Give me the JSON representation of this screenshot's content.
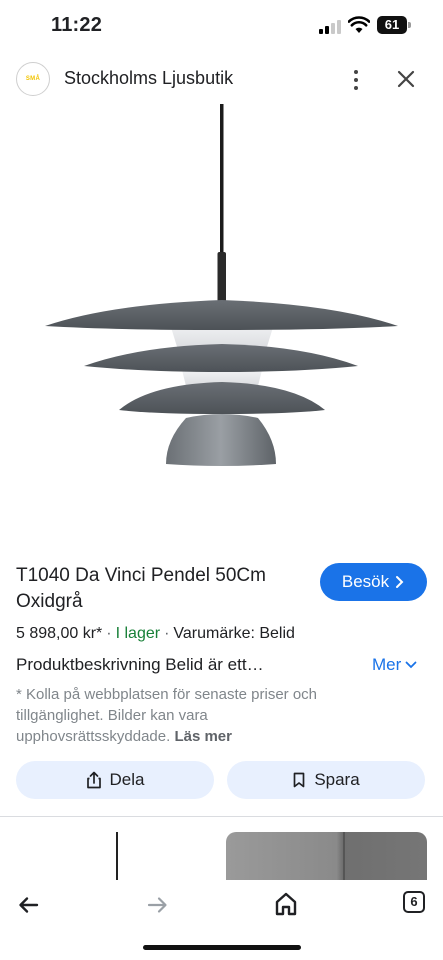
{
  "status_bar": {
    "time": "11:22",
    "battery": "61",
    "signal_bars": 4,
    "signal_active_bars": 2
  },
  "header": {
    "logo_text": "SMÅ",
    "site_name": "Stockholms Ljusbutik",
    "icons": [
      "more-vert-icon",
      "close-icon"
    ]
  },
  "product": {
    "title": "T1040 Da Vinci Pendel 50Cm Oxidgrå",
    "visit_label": "Besök",
    "price": "5 898,00 kr*",
    "stock": "I lager",
    "brand": "Varumärke: Belid",
    "description": "Produktbeskrivning Belid är ett…",
    "more_label": "Mer",
    "disclaimer": "* Kolla på webbplatsen för senaste priser och tillgänglighet. Bilder kan vara upphovsrättsskyddade.",
    "read_more": "Läs mer"
  },
  "actions": {
    "share_label": "Dela",
    "save_label": "Spara"
  },
  "bottom_nav": {
    "tab_count": "6",
    "icons": [
      "back-arrow-icon",
      "forward-arrow-icon",
      "home-icon",
      "tabs-icon"
    ]
  },
  "colors": {
    "accent": "#1a73e8",
    "pill_bg": "#e8f0fe",
    "in_stock": "#188038",
    "lamp_shade": "#5b6066"
  }
}
